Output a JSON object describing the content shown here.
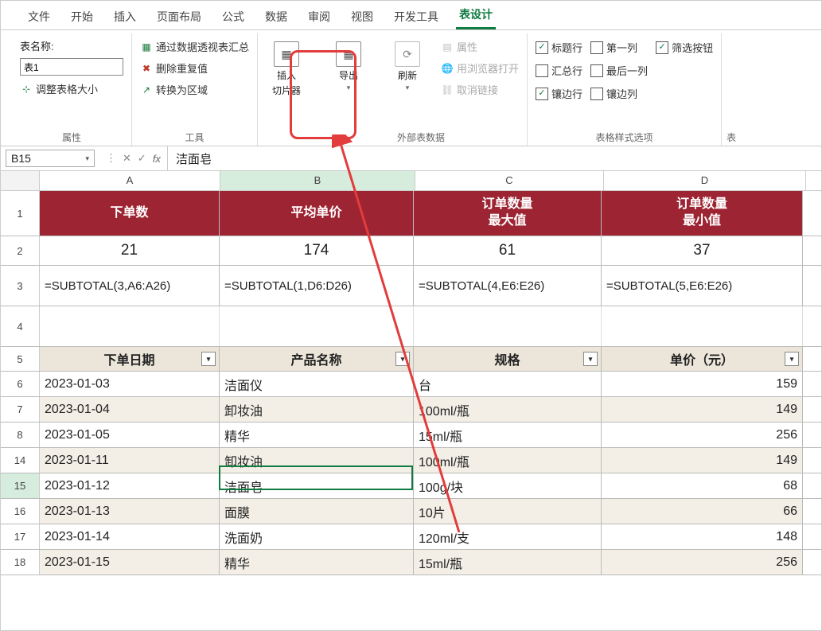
{
  "tabs": [
    "文件",
    "开始",
    "插入",
    "页面布局",
    "公式",
    "数据",
    "审阅",
    "视图",
    "开发工具",
    "表设计"
  ],
  "active_tab": 9,
  "ribbon": {
    "props": {
      "label": "属性",
      "name_label": "表名称:",
      "table_name": "表1",
      "resize": "调整表格大小"
    },
    "tools": {
      "label": "工具",
      "pivot": "通过数据透视表汇总",
      "dedupe": "删除重复值",
      "torange": "转换为区域"
    },
    "slicer": {
      "l1": "插入",
      "l2": "切片器"
    },
    "export": "导出",
    "refresh": "刷新",
    "ext": {
      "label": "外部表数据",
      "prop": "属性",
      "browser": "用浏览器打开",
      "unlink": "取消链接"
    },
    "styleopts": {
      "label": "表格样式选项",
      "r1c1": {
        "t": "标题行",
        "c": true
      },
      "r1c2": {
        "t": "第一列",
        "c": false
      },
      "r1c3": {
        "t": "筛选按钮",
        "c": true
      },
      "r2c1": {
        "t": "汇总行",
        "c": false
      },
      "r2c2": {
        "t": "最后一列",
        "c": false
      },
      "r3c1": {
        "t": "镶边行",
        "c": true
      },
      "r3c2": {
        "t": "镶边列",
        "c": false
      }
    },
    "tablestyle_label": "表"
  },
  "namebox": "B15",
  "fx_value": "洁面皂",
  "cols": [
    "A",
    "B",
    "C",
    "D"
  ],
  "header1": {
    "A": "下单数",
    "B": "平均单价",
    "C": "订单数量\n最大值",
    "D": "订单数量\n最小值"
  },
  "vals": {
    "A": "21",
    "B": "174",
    "C": "61",
    "D": "37"
  },
  "formulas": {
    "A": "=SUBTOTAL(3,A6:A26)",
    "B": "=SUBTOTAL(1,D6:D26)",
    "C": "=SUBTOTAL(4,E6:E26)",
    "D": "=SUBTOTAL(5,E6:E26)"
  },
  "tbl_headers": {
    "A": "下单日期",
    "B": "产品名称",
    "C": "规格",
    "D": "单价（元）"
  },
  "rows": [
    {
      "n": 6,
      "A": "2023-01-03",
      "B": "洁面仪",
      "C": "台",
      "D": "159"
    },
    {
      "n": 7,
      "A": "2023-01-04",
      "B": "卸妆油",
      "C": "100ml/瓶",
      "D": "149"
    },
    {
      "n": 8,
      "A": "2023-01-05",
      "B": "精华",
      "C": "15ml/瓶",
      "D": "256"
    },
    {
      "n": 14,
      "A": "2023-01-11",
      "B": "卸妆油",
      "C": "100ml/瓶",
      "D": "149"
    },
    {
      "n": 15,
      "A": "2023-01-12",
      "B": "洁面皂",
      "C": "100g/块",
      "D": "68"
    },
    {
      "n": 16,
      "A": "2023-01-13",
      "B": "面膜",
      "C": "10片",
      "D": "66"
    },
    {
      "n": 17,
      "A": "2023-01-14",
      "B": "洗面奶",
      "C": "120ml/支",
      "D": "148"
    },
    {
      "n": 18,
      "A": "2023-01-15",
      "B": "精华",
      "C": "15ml/瓶",
      "D": "256"
    }
  ],
  "icons": {
    "resize": "⊹",
    "pivot": "▦",
    "dedupe": "✖",
    "torange": "↗",
    "export": "▦",
    "refresh": "⟳",
    "prop": "▤",
    "browser": "🌐",
    "unlink": "⛓",
    "dd": "▾",
    "check": "✓",
    "filter": "▾"
  }
}
